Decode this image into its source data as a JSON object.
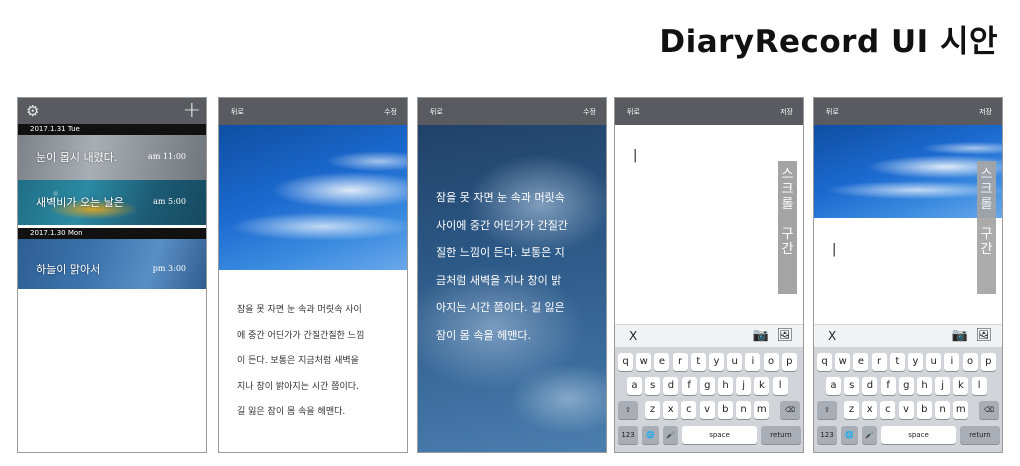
{
  "page_title": "DiaryRecord UI 시안",
  "list_screen": {
    "gear_icon": "gear-icon",
    "add_icon": "plus-icon",
    "groups": [
      {
        "date": "2017.1.31 Tue",
        "entries": [
          {
            "title": "눈이 몹시 내렸다.",
            "time": "am 11:00"
          },
          {
            "title": "새벽비가 오는 날은",
            "time": "am 5:00"
          }
        ]
      },
      {
        "date": "2017.1.30 Mon",
        "entries": [
          {
            "title": "하늘이 맑아서",
            "time": "pm 3:00"
          }
        ]
      }
    ]
  },
  "detail_screen": {
    "back": "뒤로",
    "edit": "수정",
    "lines": [
      "잠을 못 자면 눈 속과 머릿속 사이",
      "에 중간 어딘가가 간질간질한 느낌",
      "이 든다. 보통은 지금처럼 새벽을",
      "지나 창이 밝아지는 시간 쯤이다.",
      "길 잃은 잠이 몸 속을 헤맨다."
    ]
  },
  "overlay_screen": {
    "back": "뒤로",
    "edit": "수정",
    "lines": [
      "잠을 못 자면 눈 속과 머릿속",
      "사이에 중간 어딘가가 간질간",
      "질한 느낌이 든다. 보통은 지",
      "금처럼 새벽을 지나 창이 밝",
      "아지는 시간 쯤이다. 길 잃은",
      "잠이 몸 속을 헤맨다."
    ]
  },
  "write_screen": {
    "back": "뒤로",
    "save": "저장",
    "cursor": "|",
    "scroll_label": [
      "스",
      "크",
      "롤",
      "",
      "구",
      "간"
    ],
    "close": "X"
  },
  "write_image_screen": {
    "back": "뒤로",
    "save": "저장",
    "cursor": "|",
    "scroll_label": [
      "스",
      "크",
      "롤",
      "",
      "구",
      "간"
    ],
    "close": "X"
  },
  "keyboard": {
    "row1": [
      "q",
      "w",
      "e",
      "r",
      "t",
      "y",
      "u",
      "i",
      "o",
      "p"
    ],
    "row2": [
      "a",
      "s",
      "d",
      "f",
      "g",
      "h",
      "j",
      "k",
      "l"
    ],
    "row3": [
      "z",
      "x",
      "c",
      "v",
      "b",
      "n",
      "m"
    ],
    "shift": "⇧",
    "delete": "⌫",
    "num": "123",
    "globe": "🌐",
    "mic": "🎤",
    "space": "space",
    "return": "return"
  },
  "colors": {
    "topbar": "#595b60",
    "scroll_strip": "#a4a4a4",
    "keyboard_bg": "#d1d4d9"
  }
}
